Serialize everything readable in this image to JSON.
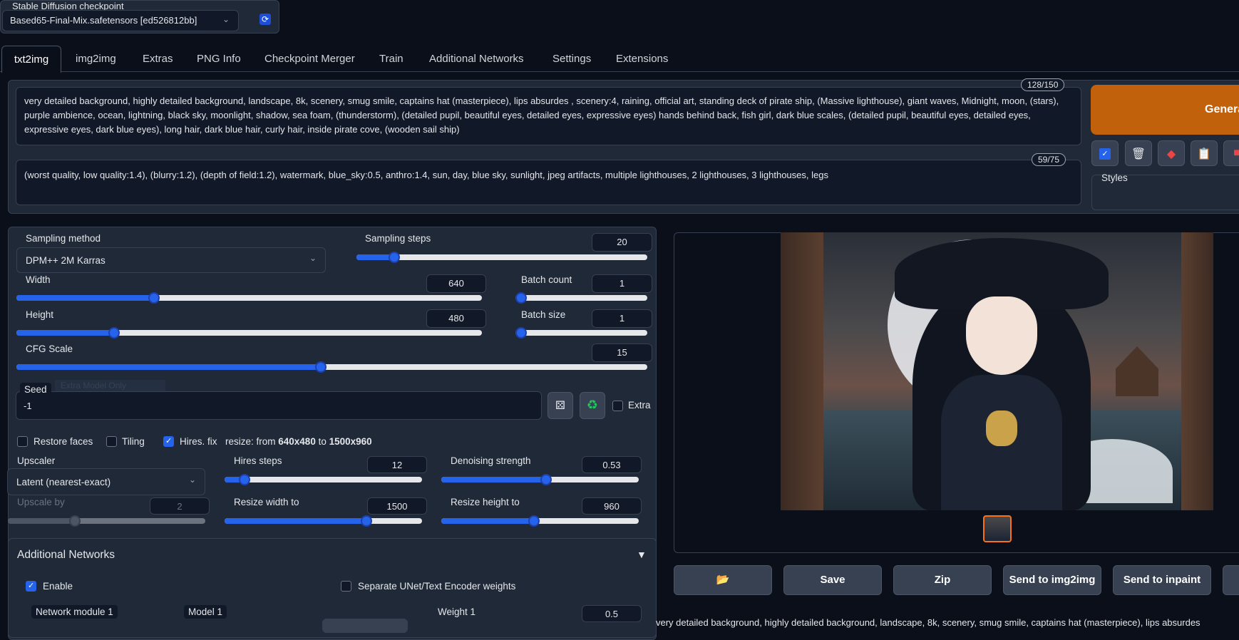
{
  "checkpoint": {
    "label": "Stable Diffusion checkpoint",
    "value": "Based65-Final-Mix.safetensors [ed526812bb]"
  },
  "tabs": [
    "txt2img",
    "img2img",
    "Extras",
    "PNG Info",
    "Checkpoint Merger",
    "Train",
    "Additional Networks",
    "Settings",
    "Extensions"
  ],
  "prompt": {
    "text": "very detailed background, highly detailed background, landscape, 8k, scenery, smug smile, captains hat (masterpiece), lips absurdes , scenery:4, raining, official art, standing deck of pirate ship,  (Massive lighthouse), giant waves, Midnight, moon, (stars), purple ambience, ocean, lightning,  black sky,  moonlight, shadow, sea foam, (thunderstorm), (detailed pupil, beautiful eyes, detailed eyes, expressive eyes) hands behind back, fish girl, dark blue scales, (detailed pupil, beautiful eyes, detailed eyes, expressive eyes, dark blue eyes), long hair, dark blue hair, curly hair,  inside pirate cove, (wooden sail ship)",
    "counter": "128/150"
  },
  "negative": {
    "text": "(worst quality, low quality:1.4), (blurry:1.2), (depth of field:1.2), watermark, blue_sky:0.5, anthro:1.4, sun, day, blue sky, sunlight, jpeg artifacts, multiple lighthouses, 2 lighthouses, 3 lighthouses, legs",
    "counter": "59/75"
  },
  "generate": "Generate",
  "styles_label": "Styles",
  "sampling": {
    "method_label": "Sampling method",
    "method": "DPM++ 2M Karras",
    "steps_label": "Sampling steps",
    "steps": "20",
    "steps_frac": 0.13
  },
  "width": {
    "label": "Width",
    "value": "640",
    "frac": 0.296
  },
  "height": {
    "label": "Height",
    "value": "480",
    "frac": 0.21
  },
  "batch_count": {
    "label": "Batch count",
    "value": "1",
    "frac": 0.0
  },
  "batch_size": {
    "label": "Batch size",
    "value": "1",
    "frac": 0.0
  },
  "cfg": {
    "label": "CFG Scale",
    "value": "15",
    "frac": 0.483
  },
  "seed": {
    "label": "Seed",
    "value": "-1",
    "extra": "Extra",
    "ghost": "Extra Model Only"
  },
  "checks": {
    "restore": "Restore faces",
    "tiling": "Tiling",
    "hires": "Hires. fix",
    "resize_pre": "resize: from ",
    "resize_from": "640x480",
    "resize_mid": " to ",
    "resize_to": "1500x960"
  },
  "upscaler": {
    "label": "Upscaler",
    "value": "Latent (nearest-exact)"
  },
  "upscale_by": {
    "label": "Upscale by",
    "value": "2",
    "frac": 0.34
  },
  "hires_steps": {
    "label": "Hires steps",
    "value": "12",
    "frac": 0.1
  },
  "denoise": {
    "label": "Denoising strength",
    "value": "0.53",
    "frac": 0.53
  },
  "resize_w": {
    "label": "Resize width to",
    "value": "1500",
    "frac": 0.72
  },
  "resize_h": {
    "label": "Resize height to",
    "value": "960",
    "frac": 0.47
  },
  "addnet": {
    "title": "Additional Networks",
    "enable": "Enable",
    "separate": "Separate UNet/Text Encoder weights",
    "module": "Network module 1",
    "model": "Model 1",
    "weight": "Weight 1",
    "weight_value": "0.5"
  },
  "output_buttons": {
    "save": "Save",
    "zip": "Zip",
    "img2img": "Send to img2img",
    "inpaint": "Send to inpaint"
  },
  "output_caption": "very detailed background, highly detailed background, landscape, 8k, scenery, smug smile, captains hat (masterpiece), lips absurdes",
  "colors": {
    "accent": "#2563eb",
    "generate": "#c2610c",
    "bg": "#0b0f19",
    "panel": "#1f2937"
  }
}
